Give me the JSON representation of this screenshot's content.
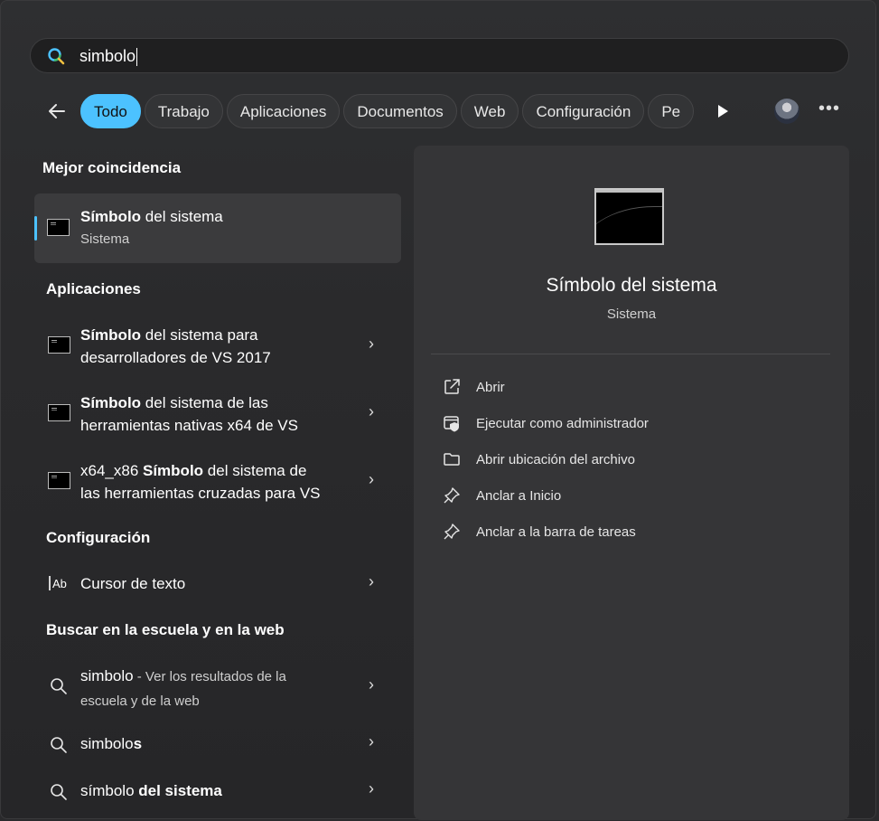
{
  "search": {
    "query": "simbolo"
  },
  "filters": {
    "chips": [
      "Todo",
      "Trabajo",
      "Aplicaciones",
      "Documentos",
      "Web",
      "Configuración",
      "Pe"
    ],
    "active": "Todo"
  },
  "left": {
    "best_heading": "Mejor coincidencia",
    "best": {
      "title_bold": "Símbolo",
      "title_rest": " del sistema",
      "subtitle": "Sistema"
    },
    "apps_heading": "Aplicaciones",
    "apps": [
      {
        "line1_bold": "Símbolo",
        "line1_rest": " del sistema para",
        "line2": "desarrolladores de VS 2017"
      },
      {
        "line1_bold": "Símbolo",
        "line1_rest": " del sistema de las",
        "line2": "herramientas nativas x64 de VS"
      },
      {
        "line1_pre": "x64_x86 ",
        "line1_bold": "Símbolo",
        "line1_rest": " del sistema de",
        "line2": "las herramientas cruzadas para VS"
      }
    ],
    "config_heading": "Configuración",
    "config": {
      "label": "Cursor de texto"
    },
    "web_heading": "Buscar en la escuela y en la web",
    "web": [
      {
        "main": "simbolo",
        "hint": " - Ver los resultados de la",
        "hint2": "escuela y de la web"
      },
      {
        "main": "simbolo",
        "tail": "s"
      },
      {
        "main": "símbolo",
        "bold": " del sistema"
      }
    ]
  },
  "panel": {
    "title": "Símbolo del sistema",
    "subtitle": "Sistema",
    "actions": [
      "Abrir",
      "Ejecutar como administrador",
      "Abrir ubicación del archivo",
      "Anclar a Inicio",
      "Anclar a la barra de tareas"
    ]
  },
  "colors": {
    "accent": "#4cc2ff",
    "background": "#2a2a2c",
    "panel": "#353537"
  }
}
